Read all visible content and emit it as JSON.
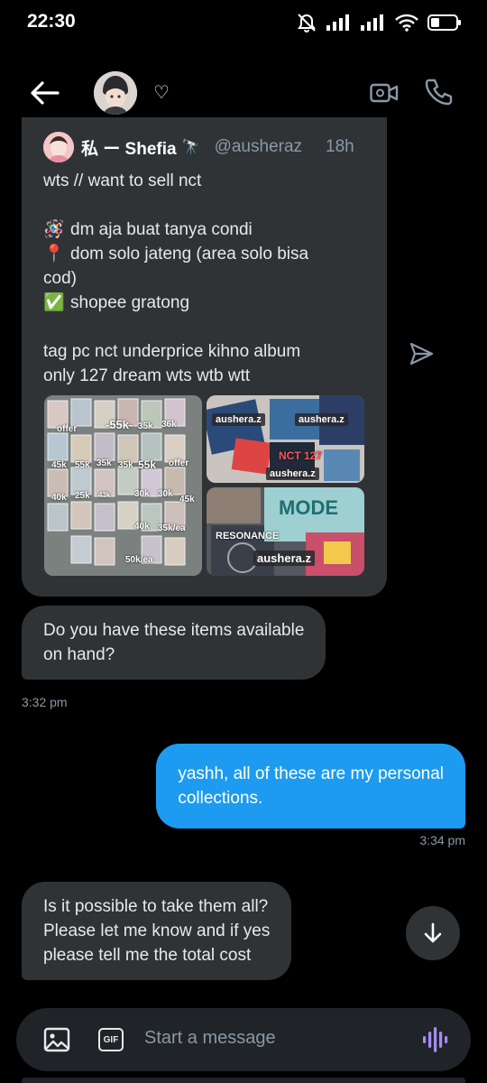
{
  "status_bar": {
    "time": "22:30"
  },
  "header": {
    "name_symbol": "♡"
  },
  "tweet": {
    "author_name": "私 ー Shefia",
    "author_emoji": "🔭",
    "handle": "@ausheraz",
    "time": "18h",
    "lines": {
      "l1": "wts // want to sell nct",
      "l2": "dm aja buat tanya condi",
      "l3": "dom solo jateng (area solo bisa",
      "l4": "cod)",
      "l5": "shopee gratong",
      "l6": "tag pc nct underprice kihno album",
      "l7": "only 127 dream wts wtb wtt"
    },
    "emojis": {
      "e2": "🪅",
      "e3": "📍",
      "e5": "✅"
    },
    "media": {
      "left_tags": [
        "-55k-",
        "35k",
        "36k",
        "45k",
        "55k",
        "35k",
        "35k",
        "55k",
        "offer",
        "40k",
        "25k",
        "43k",
        "30k",
        "30k",
        "45k",
        "40k",
        "35k/ea",
        "50k/ea",
        "offer",
        "offer"
      ],
      "watermark_1": "aushera.z",
      "watermark_2": "aushera.z",
      "watermark_3": "aushera.z",
      "watermark_4": "aushera.z",
      "cover_text_1": "NCT 127",
      "cover_text_2": "RESONANCE",
      "cover_text_3": "MODE"
    }
  },
  "messages": {
    "m1": {
      "line1": "Do you have these items available",
      "line2": "on hand?",
      "time": "3:32 pm"
    },
    "m2": {
      "line1": "yashh, all of these are my personal",
      "line2": "collections.",
      "time": "3:34 pm"
    },
    "m3": {
      "line1": "Is it possible to take them all?",
      "line2": "Please let me know and if yes",
      "line3": "please tell me the total cost"
    }
  },
  "composer": {
    "gif_label": "GIF",
    "placeholder": "Start a message"
  },
  "colors": {
    "accent": "#1d9bf0",
    "bubble_received": "#2f3336",
    "voice_icon": "#a58bf7",
    "background": "#000000"
  }
}
